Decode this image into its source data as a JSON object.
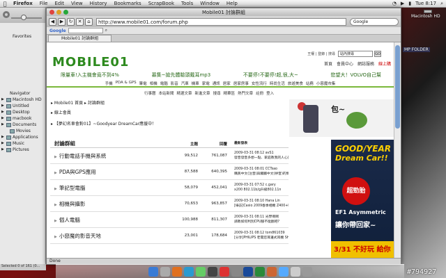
{
  "menubar": {
    "app": "Firefox",
    "items": [
      "File",
      "Edit",
      "View",
      "History",
      "Bookmarks",
      "ScrapBook",
      "Tools",
      "Window",
      "Help"
    ],
    "clock": "Tue 8:17"
  },
  "desktop": {
    "hd_label": "Macintosh HD",
    "stamp": "#794927",
    "finder_tag": "MP FOLDER"
  },
  "finder": {
    "favorites": "Favorites",
    "navigator": "Navigator",
    "items": [
      {
        "label": "Macintosh HD"
      },
      {
        "label": "Untitled"
      },
      {
        "label": "Desktop"
      },
      {
        "label": "macbook"
      },
      {
        "label": "Documents"
      },
      {
        "label": "Movies"
      },
      {
        "label": "Applications"
      },
      {
        "label": "Music"
      },
      {
        "label": "Pictures"
      }
    ],
    "status": "Selected 0 of 161 (0..."
  },
  "firefox": {
    "title": "Mobile01 討論群組",
    "url": "http://www.mobile01.com/forum.php",
    "google": "Google",
    "tab": "Mobile01 討論群組",
    "status": "Done"
  },
  "site": {
    "logo": "MOBILE01",
    "top_links": "王權 | 登錄 | 搜尋",
    "search_placeholder": "站內搜尋",
    "search_go": "GO",
    "user_links": [
      "首頁",
      "會員中心",
      "網誌服務",
      "線上購"
    ],
    "ads": [
      "限量車!入主機會竟不到4%",
      "募集~搶先體驗頭戴耳mp3",
      "不要停!不要停!超,很,大~",
      "慾望大！VOLVO自己幫"
    ],
    "main_nav": [
      "手機",
      "PDA & GPS",
      "筆電",
      "相機",
      "電腦",
      "影音",
      "汽車",
      "機車",
      "家電",
      "通訊",
      "居家",
      "居家房事",
      "女性流行",
      "時尚生活",
      "旅遊美食",
      "站務",
      "小惡魔市集"
    ],
    "sub_nav": [
      "行事曆",
      "本站新聞",
      "精選文章",
      "新進文章",
      "搜尋",
      "精華區",
      "熱門文章",
      "註冊",
      "登入"
    ],
    "breadcrumb": "▸ Mobile01 首頁 ▸ 討論群組",
    "member": "▸ 線上會員",
    "notice": "▸ 【夢幻名車會對01】~Goodyear DreamCar應援中！",
    "banner_text": "包~"
  },
  "forum": {
    "headers": {
      "name": "討論群組",
      "topics": "主題",
      "replies": "回覆",
      "latest": "最新發表"
    },
    "rows": [
      {
        "name": "行動電話手機與系統",
        "topics": "99,512",
        "replies": "761,087",
        "latest_time": "2009-03-31 08:12 avS1",
        "latest_title": "發音發音多想一點、家庭教我的人心靈學 (後後讀書、事..."
      },
      {
        "name": "PDA與GPS應用",
        "topics": "87,588",
        "replies": "640,395",
        "latest_time": "2009-03-31 08:01 CCTsao",
        "latest_title": "購買中文(注音)與觸觸中文(拼音)的問題"
      },
      {
        "name": "筆記型電腦",
        "topics": "58,079",
        "replies": "452,041",
        "latest_time": "2009-03-31 07:52 c.gary",
        "latest_title": "x200 802.11b/g升級802.11n"
      },
      {
        "name": "相機與攝影",
        "topics": "70,653",
        "replies": "963,857",
        "latest_time": "2009-03-31 08:10 Hana Lin",
        "latest_title": "[綠訪]Casio 2009春季相機 Z400+F5..."
      },
      {
        "name": "個人電腦",
        "topics": "100,988",
        "replies": "811,307",
        "latest_time": "2009-03-31 08:11 光學啊啊",
        "latest_title": "請教如何判別CPU腳不能翻吧?"
      },
      {
        "name": "小惡魔的影音天地",
        "topics": "23,001",
        "replies": "178,684",
        "latest_time": "2009-03-31 08:12 tom861039",
        "latest_title": "[分享]PHILIPS 老開您耳邊式耳機 SHE85..."
      }
    ]
  },
  "side_ad": {
    "line1": "GOOD/YEAR",
    "line2": "Dream Car!!",
    "circle": "超勁胎",
    "ef1": "EF1 Asymmetric",
    "win": "讓你帶回家~",
    "promo": "3/31 不好玩 給你"
  }
}
